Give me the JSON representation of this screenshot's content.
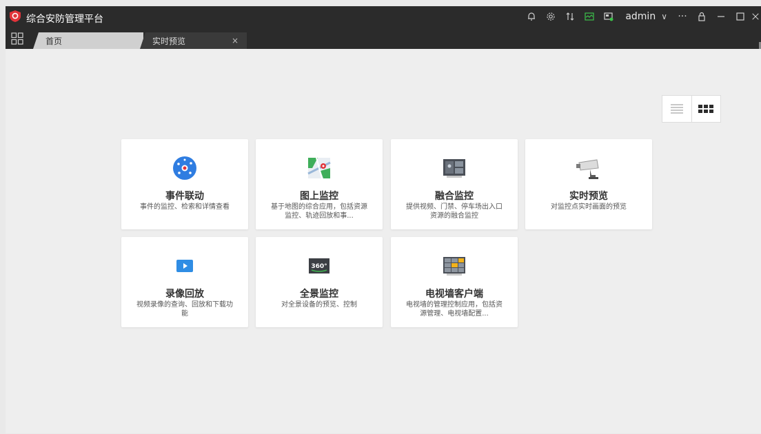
{
  "app": {
    "title": "综合安防管理平台"
  },
  "header": {
    "username": "admin"
  },
  "tabs": [
    {
      "label": "首页"
    },
    {
      "label": "实时预览",
      "close": "×"
    }
  ],
  "colors": {
    "brand_red": "#e2333a",
    "accent_blue": "#2f7de1"
  },
  "cards": [
    {
      "title": "事件联动",
      "desc": "事件的监控、检索和详情查看",
      "icon": "event-linkage-icon"
    },
    {
      "title": "图上监控",
      "desc": "基于地图的综合应用，包括资源监控、轨迹回放和事...",
      "icon": "map-monitor-icon"
    },
    {
      "title": "融合监控",
      "desc": "提供视频、门禁、停车场出入口资源的融合监控",
      "icon": "fusion-monitor-icon"
    },
    {
      "title": "实时预览",
      "desc": "对监控点实时画面的预览",
      "icon": "camera-icon"
    },
    {
      "title": "录像回放",
      "desc": "视频录像的查询、回放和下载功能",
      "icon": "playback-icon"
    },
    {
      "title": "全景监控",
      "desc": "对全景设备的预览、控制",
      "icon": "panorama-360-icon"
    },
    {
      "title": "电视墙客户端",
      "desc": "电视墙的管理控制应用，包括资源管理、电视墙配置...",
      "icon": "tv-wall-icon"
    }
  ]
}
